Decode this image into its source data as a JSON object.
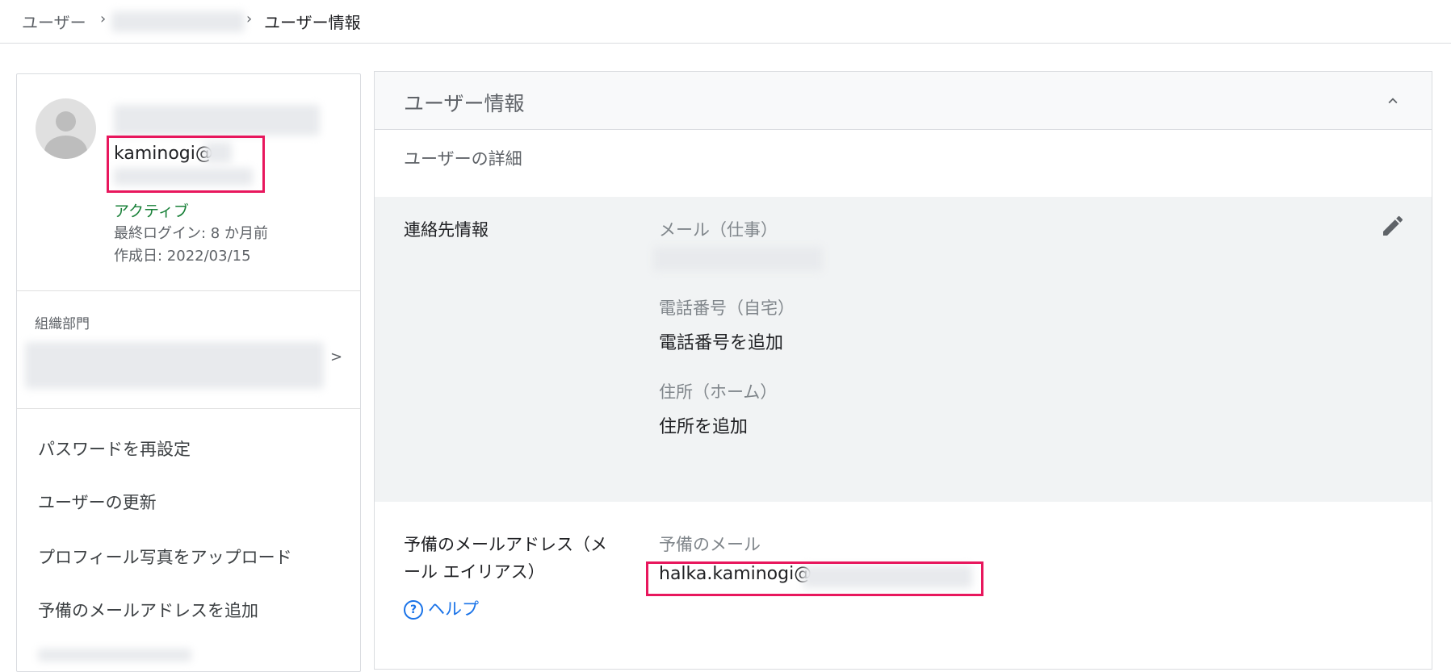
{
  "breadcrumb": {
    "root": "ユーザー",
    "separator": "›",
    "current": "ユーザー情報"
  },
  "profile": {
    "email_local": "kaminogi@",
    "status": "アクティブ",
    "last_login": "最終ログイン: 8 か月前",
    "created": "作成日: 2022/03/15",
    "org_unit_label": "組織部門",
    "org_arrow": ">"
  },
  "actions": [
    "パスワードを再設定",
    "ユーザーの更新",
    "プロフィール写真をアップロード",
    "予備のメールアドレスを追加"
  ],
  "panel": {
    "title": "ユーザー情報",
    "subtitle": "ユーザーの詳細"
  },
  "contact": {
    "section_label": "連絡先情報",
    "work_email_label": "メール（仕事）",
    "home_phone_label": "電話番号（自宅）",
    "home_phone_value": "電話番号を追加",
    "home_address_label": "住所（ホーム）",
    "home_address_value": "住所を追加"
  },
  "alias": {
    "section_label_line1": "予備のメールアドレス（メ",
    "section_label_line2": "ール エイリアス）",
    "help_label": "ヘルプ",
    "field_label": "予備のメール",
    "value": "halka.kaminogi@"
  },
  "icons": {
    "pencil": "pencil-icon",
    "chevron_up": "chevron-up-icon",
    "help": "help-circle-icon",
    "avatar": "avatar-placeholder-icon"
  },
  "colors": {
    "active_status": "#188038",
    "link": "#1a73e8",
    "highlight": "#e8175d"
  }
}
